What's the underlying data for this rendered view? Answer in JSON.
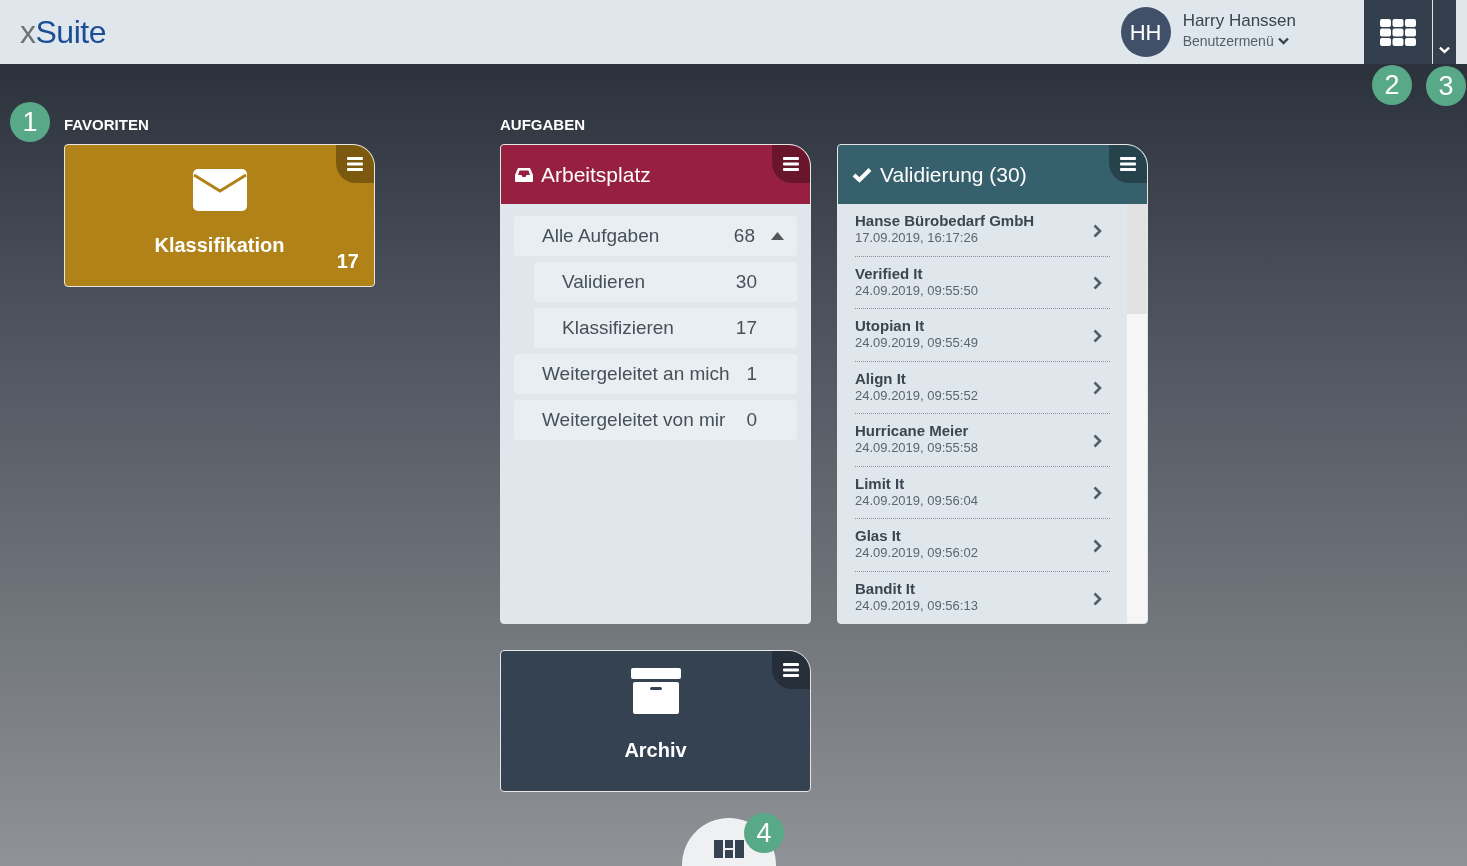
{
  "header": {
    "logo": {
      "prefix": "x",
      "rest": "Suite"
    },
    "user": {
      "initials": "HH",
      "name": "Harry Hanssen",
      "menu_label": "Benutzermenü"
    }
  },
  "favorites": {
    "heading": "FAVORITEN",
    "tiles": [
      {
        "label": "Klassifikation",
        "count": "17",
        "color": "#b08217"
      }
    ]
  },
  "tasks": {
    "heading": "AUFGABEN",
    "workplace": {
      "title": "Arbeitsplatz",
      "color": "#972041",
      "items": [
        {
          "label": "Alle Aufgaben",
          "count": "68",
          "expanded": true,
          "children": [
            {
              "label": "Validieren",
              "count": "30"
            },
            {
              "label": "Klassifizieren",
              "count": "17"
            }
          ]
        },
        {
          "label": "Weitergeleitet an mich",
          "count": "1"
        },
        {
          "label": "Weitergeleitet von mir",
          "count": "0"
        }
      ]
    },
    "validation": {
      "title": "Validierung (30)",
      "color": "#37606d",
      "items": [
        {
          "name": "Hanse Bürobedarf GmbH",
          "date": "17.09.2019, 16:17:26"
        },
        {
          "name": "Verified It",
          "date": "24.09.2019, 09:55:50"
        },
        {
          "name": "Utopian It",
          "date": "24.09.2019, 09:55:49"
        },
        {
          "name": "Align It",
          "date": "24.09.2019, 09:55:52"
        },
        {
          "name": "Hurricane Meier",
          "date": "24.09.2019, 09:55:58"
        },
        {
          "name": "Limit It",
          "date": "24.09.2019, 09:56:04"
        },
        {
          "name": "Glas It",
          "date": "24.09.2019, 09:56:02"
        },
        {
          "name": "Bandit It",
          "date": "24.09.2019, 09:56:13"
        }
      ]
    },
    "archive": {
      "label": "Archiv",
      "color": "#354252"
    }
  },
  "callouts": [
    "1",
    "2",
    "3",
    "4"
  ]
}
